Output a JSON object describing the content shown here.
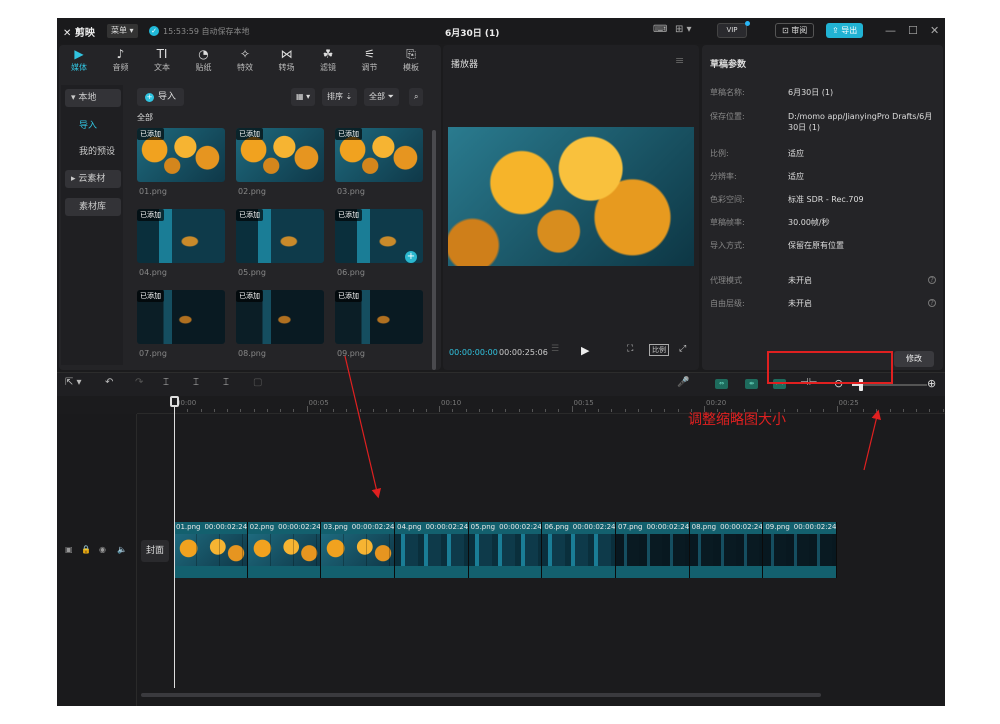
{
  "titlebar": {
    "brand": "剪映",
    "menu": "菜单",
    "save_check": "✓",
    "save_status": "15:53:59 自动保存本地",
    "project_title": "6月30日 (1)",
    "vip": "VIP",
    "review": "审阅",
    "export": "导出"
  },
  "toolbar": {
    "tabs": [
      {
        "icon": "▶",
        "label": "媒体"
      },
      {
        "icon": "♪",
        "label": "音频"
      },
      {
        "icon": "TI",
        "label": "文本"
      },
      {
        "icon": "◔",
        "label": "贴纸"
      },
      {
        "icon": "✧",
        "label": "特效"
      },
      {
        "icon": "⋈",
        "label": "转场"
      },
      {
        "icon": "☘",
        "label": "滤镜"
      },
      {
        "icon": "⚟",
        "label": "调节"
      },
      {
        "icon": "⎘",
        "label": "模板"
      }
    ]
  },
  "side_nav": [
    "本地",
    "导入",
    "我的预设",
    "云素材",
    "素材库"
  ],
  "media": {
    "import_label": "导入",
    "sort_label": "排序",
    "all_label": "全部",
    "section": "全部",
    "added_tag": "已添加",
    "items": [
      "01.png",
      "02.png",
      "03.png",
      "04.png",
      "05.png",
      "06.png",
      "07.png",
      "08.png",
      "09.png"
    ]
  },
  "player": {
    "title": "播放器",
    "current_time": "00:00:00:00",
    "total_time": "00:00:25:06",
    "ratio_label": "比例"
  },
  "props": {
    "title": "草稿参数",
    "edit_label": "修改",
    "rows": [
      {
        "label": "草稿名称:",
        "value": "6月30日 (1)"
      },
      {
        "label": "保存位置:",
        "value": "D:/momo app/JianyingPro Drafts/6月30日 (1)"
      },
      {
        "label": "比例:",
        "value": "适应"
      },
      {
        "label": "分辨率:",
        "value": "适应"
      },
      {
        "label": "色彩空间:",
        "value": "标准 SDR - Rec.709"
      },
      {
        "label": "草稿帧率:",
        "value": "30.00帧/秒"
      },
      {
        "label": "导入方式:",
        "value": "保留在原有位置"
      },
      {
        "label": "代理模式",
        "value": "未开启"
      },
      {
        "label": "自由层级:",
        "value": "未开启"
      }
    ]
  },
  "timeline": {
    "ruler": [
      "00:00",
      "00:05",
      "00:10",
      "00:15",
      "00:20",
      "00:25"
    ],
    "cover_label": "封面",
    "zoom_level": 0.12,
    "clips": [
      {
        "name": "01.png",
        "dur": "00:00:02:24"
      },
      {
        "name": "02.png",
        "dur": "00:00:02:24"
      },
      {
        "name": "03.png",
        "dur": "00:00:02:24"
      },
      {
        "name": "04.png",
        "dur": "00:00:02:24"
      },
      {
        "name": "05.png",
        "dur": "00:00:02:24"
      },
      {
        "name": "06.png",
        "dur": "00:00:02:24"
      },
      {
        "name": "07.png",
        "dur": "00:00:02:24"
      },
      {
        "name": "08.png",
        "dur": "00:00:02:24"
      },
      {
        "name": "09.png",
        "dur": "00:00:02:24"
      }
    ]
  },
  "annotation": {
    "text": "调整缩略图大小",
    "color": "#e02020"
  },
  "colors": {
    "accent": "#21b3d4",
    "clip": "#13606e"
  }
}
